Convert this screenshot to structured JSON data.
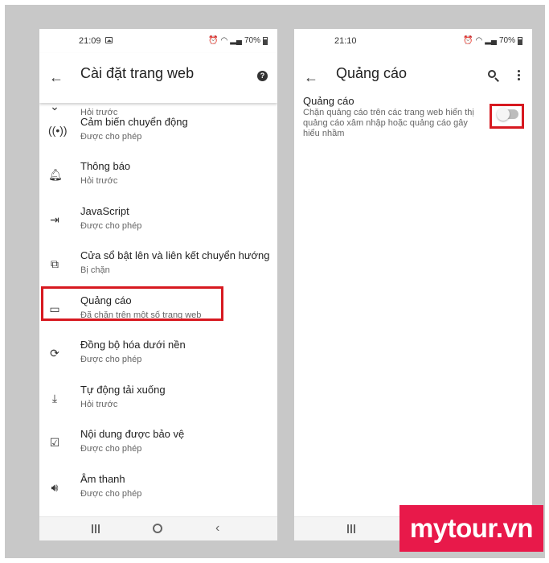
{
  "left_screen": {
    "status": {
      "time": "21:09",
      "battery": "70%"
    },
    "title": "Cài đặt trang web",
    "items": [
      {
        "label": "",
        "sub": "Hỏi trước",
        "icon": "location-icon"
      },
      {
        "label": "Cảm biến chuyển động",
        "sub": "Được cho phép",
        "icon": "motion-sensor-icon"
      },
      {
        "label": "Thông báo",
        "sub": "Hỏi trước",
        "icon": "bell-icon"
      },
      {
        "label": "JavaScript",
        "sub": "Được cho phép",
        "icon": "javascript-icon"
      },
      {
        "label": "Cửa sổ bật lên và liên kết chuyển hướng",
        "sub": "Bị chặn",
        "icon": "popup-icon"
      },
      {
        "label": "Quảng cáo",
        "sub": "Đã chặn trên một số trang web",
        "icon": "ads-window-icon"
      },
      {
        "label": "Đồng bộ hóa dưới nền",
        "sub": "Được cho phép",
        "icon": "sync-icon"
      },
      {
        "label": "Tự động tải xuống",
        "sub": "Hỏi trước",
        "icon": "download-icon"
      },
      {
        "label": "Nội dung được bảo vệ",
        "sub": "Được cho phép",
        "icon": "protected-content-icon"
      },
      {
        "label": "Âm thanh",
        "sub": "Được cho phép",
        "icon": "sound-icon"
      }
    ]
  },
  "right_screen": {
    "status": {
      "time": "21:10",
      "battery": "70%"
    },
    "title": "Quảng cáo",
    "setting": {
      "title": "Quảng cáo",
      "description": "Chặn quảng cáo trên các trang web hiển thị quảng cáo xâm nhập hoặc quảng cáo gây hiểu nhầm",
      "enabled": false
    }
  },
  "watermark": "mytour.vn",
  "colors": {
    "highlight": "#d71920",
    "watermark_bg": "#e8194a"
  }
}
